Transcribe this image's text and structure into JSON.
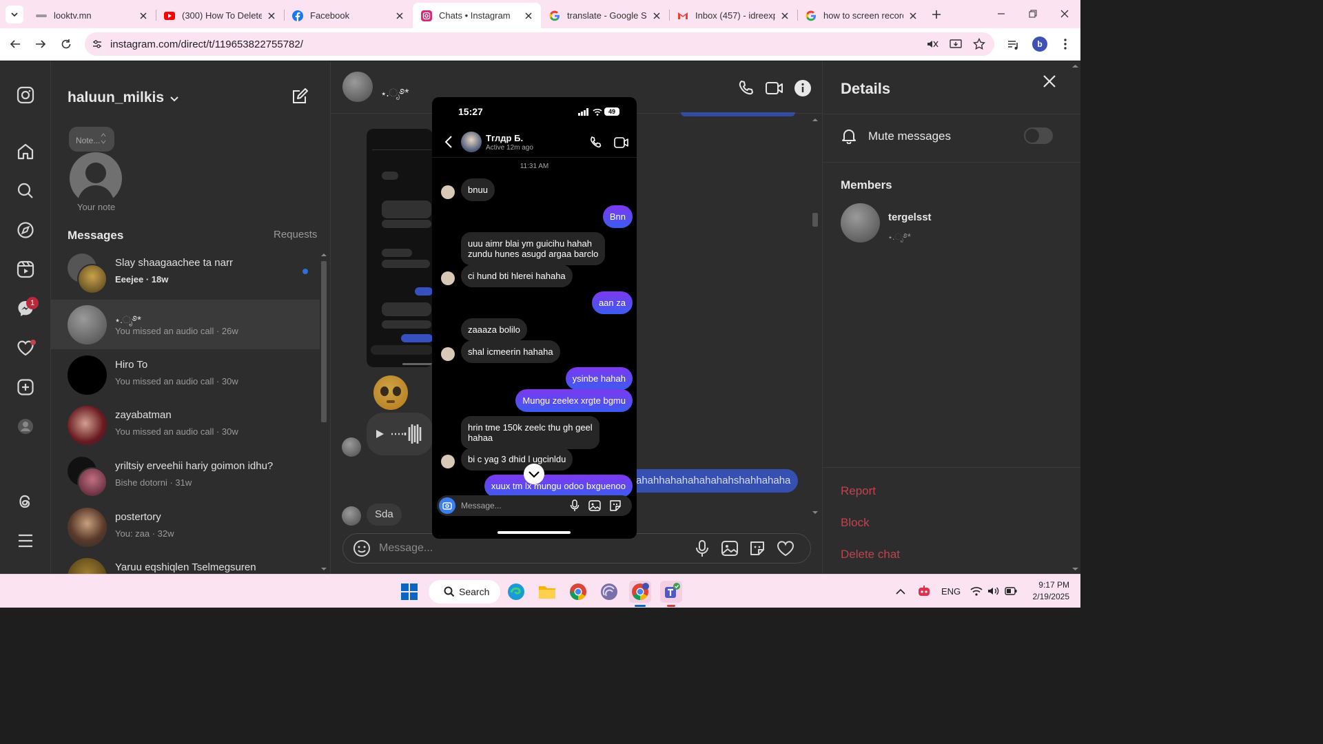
{
  "browser": {
    "tabs": [
      {
        "title": "looktv.mn",
        "icon": "looktv-icon",
        "active": false
      },
      {
        "title": "(300) How To Delete",
        "icon": "youtube-icon",
        "active": false
      },
      {
        "title": "Facebook",
        "icon": "facebook-icon",
        "active": false
      },
      {
        "title": "Chats • Instagram",
        "icon": "instagram-icon",
        "active": true
      },
      {
        "title": "translate - Google Se",
        "icon": "google-icon",
        "active": false
      },
      {
        "title": "Inbox (457) - idreexp",
        "icon": "gmail-icon",
        "active": false
      },
      {
        "title": "how to screen record",
        "icon": "google-icon",
        "active": false
      }
    ],
    "url": "instagram.com/direct/t/119653822755782/",
    "profile_letter": "b"
  },
  "sidebar": {
    "username": "haluun_milkis",
    "note_placeholder": "Note...",
    "your_note": "Your note",
    "messages_heading": "Messages",
    "requests_label": "Requests",
    "notification_count": "1"
  },
  "conversations": [
    {
      "name": "Slay shaagaachee ta narr",
      "sub": "Eeejee · 18w",
      "unread": true
    },
    {
      "name": "⋆.ೃ࿔*",
      "sub": "You missed an audio call · 26w",
      "unread": false
    },
    {
      "name": "Hiro To",
      "sub": "You missed an audio call · 30w",
      "unread": false
    },
    {
      "name": "zayabatman",
      "sub": "You missed an audio call · 30w",
      "unread": false
    },
    {
      "name": "yriltsiy erveehii hariy goimon idhu?",
      "sub": "Bishe dotorni · 31w",
      "unread": false
    },
    {
      "name": "postertory",
      "sub": "You: zaa · 32w",
      "unread": false
    },
    {
      "name": "Yaruu eqshiqlen Tselmegsuren",
      "sub": "",
      "unread": false
    }
  ],
  "chat": {
    "title": "⋆.ೃ࿔*",
    "sent_partial_text": "ahahhahahahahahahshahhahaha",
    "last_message": "Sda",
    "input_placeholder": "Message..."
  },
  "details": {
    "title": "Details",
    "mute_label": "Mute messages",
    "mute_on": false,
    "members_heading": "Members",
    "member_name": "tergelsst",
    "member_sub": "⋆.ೃ࿔*",
    "report": "Report",
    "block": "Block",
    "delete_chat": "Delete chat"
  },
  "phone": {
    "time": "15:27",
    "battery": "49",
    "contact_name": "Тглдр Б.",
    "contact_status": "Active 12m ago",
    "timestamp": "11:31 AM",
    "messages": [
      {
        "dir": "in",
        "text": "bnuu"
      },
      {
        "dir": "out",
        "text": "Bnn"
      },
      {
        "dir": "in",
        "text": "uuu aimr blai ym guicihu hahah\nzundu hunes asugd argaa barclo"
      },
      {
        "dir": "in",
        "text": "ci hund bti hlerei hahaha"
      },
      {
        "dir": "out",
        "text": "aan za"
      },
      {
        "dir": "in",
        "text": "zaaaza bolilo"
      },
      {
        "dir": "in",
        "text": "shal icmeerin hahaha"
      },
      {
        "dir": "out",
        "text": "ysinbe hahah"
      },
      {
        "dir": "out",
        "text": "Mungu zeelex xrgte bgmu"
      },
      {
        "dir": "in",
        "text": "hrin tme 150k zeelc thu gh geel\nhahaa"
      },
      {
        "dir": "in",
        "text": "bi c yag 3 dhid l ugcinldu"
      },
      {
        "dir": "out",
        "text": "xuux tm lx mungu odoo bxguenoo"
      }
    ],
    "input_placeholder": "Message..."
  },
  "taskbar": {
    "search_label": "Search",
    "language": "ENG",
    "time": "9:17 PM",
    "date": "2/19/2025"
  },
  "colors": {
    "accent": "#3b5cf0",
    "accent_purple": "#7d38f0",
    "danger": "#c0434d",
    "chrome_tab_bar": "#fbe3f1",
    "page_dim": "#2d2d2d"
  }
}
